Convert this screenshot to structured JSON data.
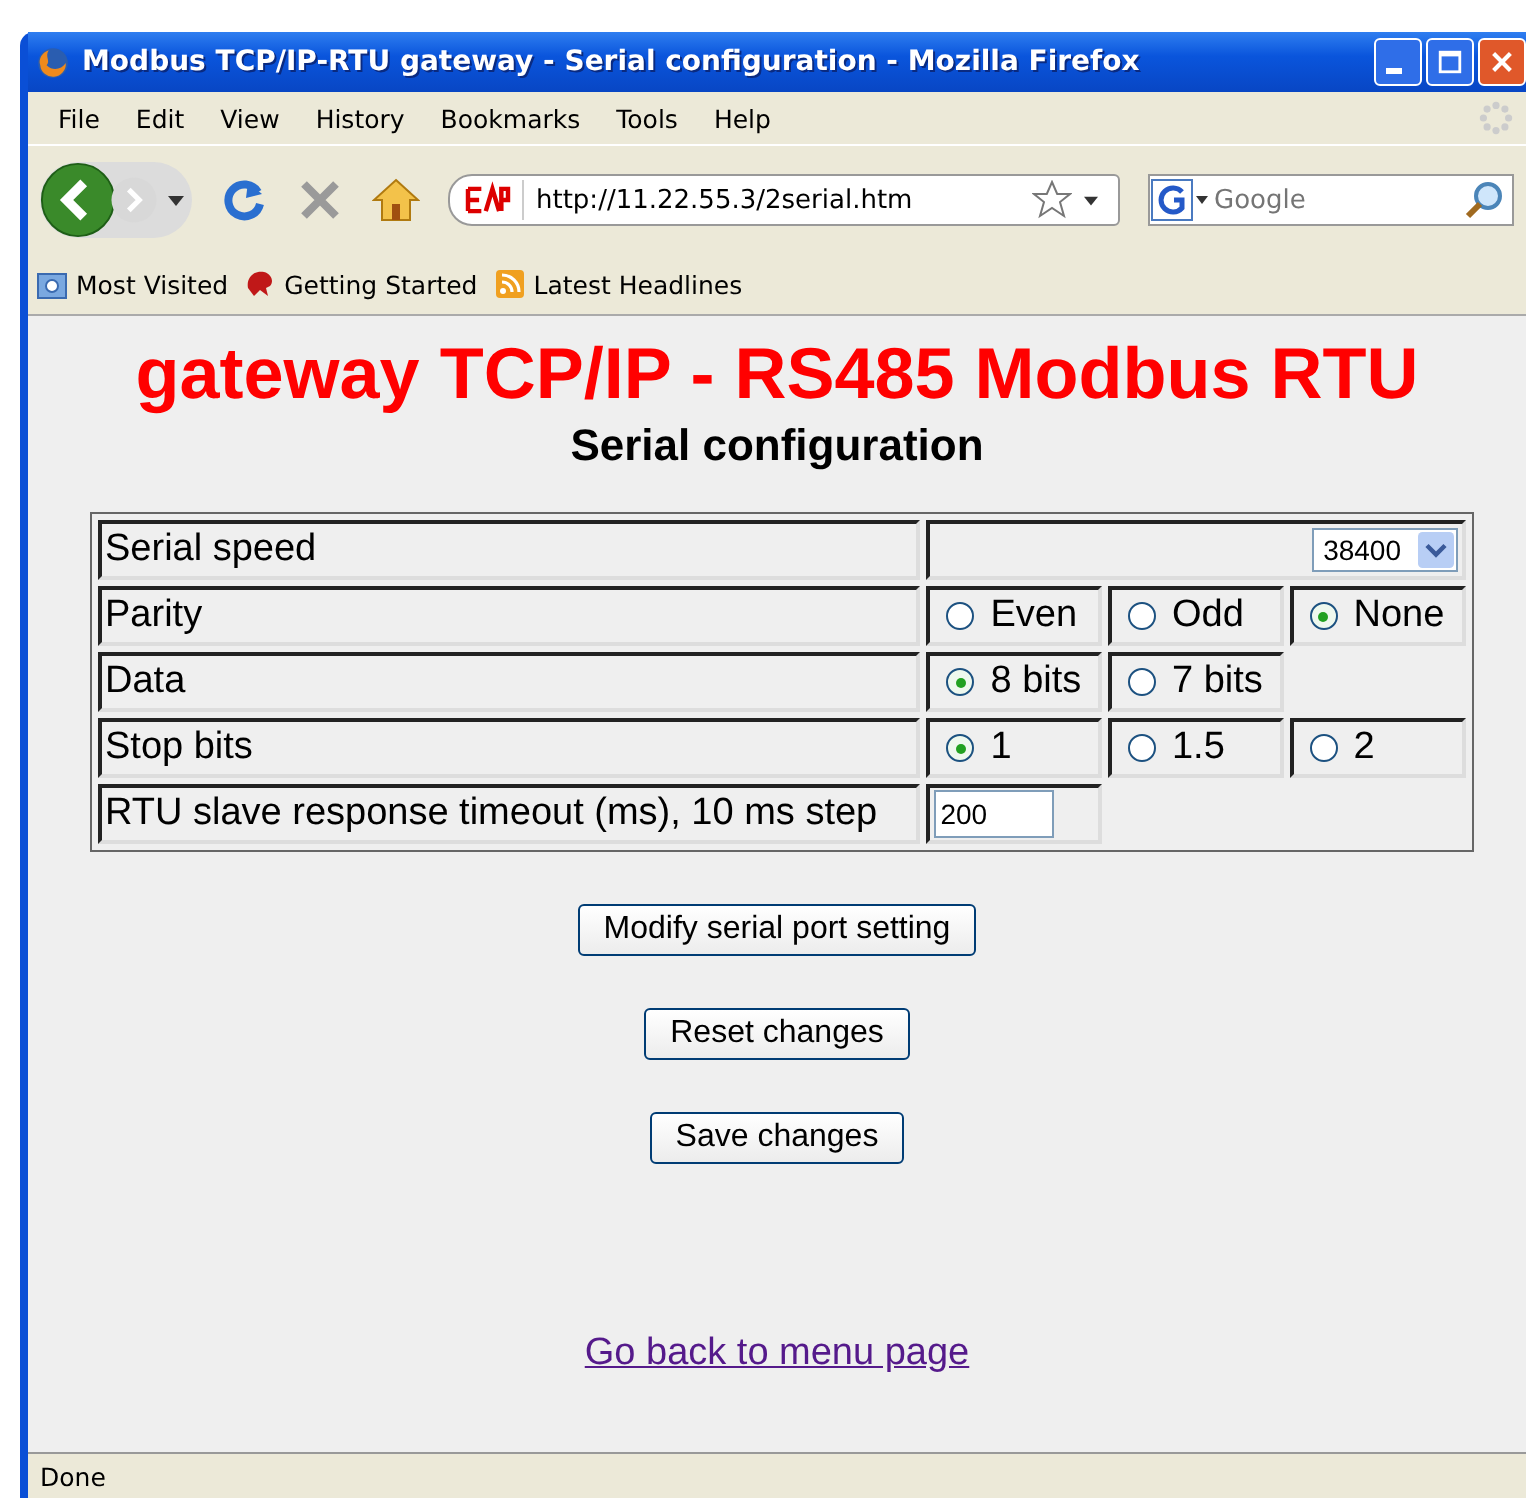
{
  "window": {
    "title": "Modbus TCP/IP-RTU gateway - Serial configuration - Mozilla Firefox"
  },
  "menu": [
    "File",
    "Edit",
    "View",
    "History",
    "Bookmarks",
    "Tools",
    "Help"
  ],
  "address_bar": {
    "value": "http://11.22.55.3/2serial.htm"
  },
  "search": {
    "placeholder": "Google"
  },
  "bookmarks": [
    "Most Visited",
    "Getting Started",
    "Latest Headlines"
  ],
  "page": {
    "heading": "gateway TCP/IP - RS485 Modbus RTU",
    "subheading": "Serial configuration",
    "rows": [
      {
        "kind": "select",
        "label": "Serial speed",
        "value": "38400"
      },
      {
        "kind": "radio",
        "label": "Parity",
        "options": [
          {
            "label": "Even",
            "selected": false
          },
          {
            "label": "Odd",
            "selected": false
          },
          {
            "label": "None",
            "selected": true
          }
        ]
      },
      {
        "kind": "radio",
        "label": "Data",
        "options": [
          {
            "label": "8 bits",
            "selected": true
          },
          {
            "label": "7 bits",
            "selected": false
          }
        ]
      },
      {
        "kind": "radio",
        "label": "Stop bits",
        "options": [
          {
            "label": "1",
            "selected": true
          },
          {
            "label": "1.5",
            "selected": false
          },
          {
            "label": "2",
            "selected": false
          }
        ]
      },
      {
        "kind": "text",
        "label": "RTU slave response timeout (ms), 10 ms step",
        "value": "200"
      }
    ],
    "buttons": [
      "Modify serial port setting",
      "Reset changes",
      "Save changes"
    ],
    "link": "Go back to menu page"
  },
  "status_bar": "Done"
}
